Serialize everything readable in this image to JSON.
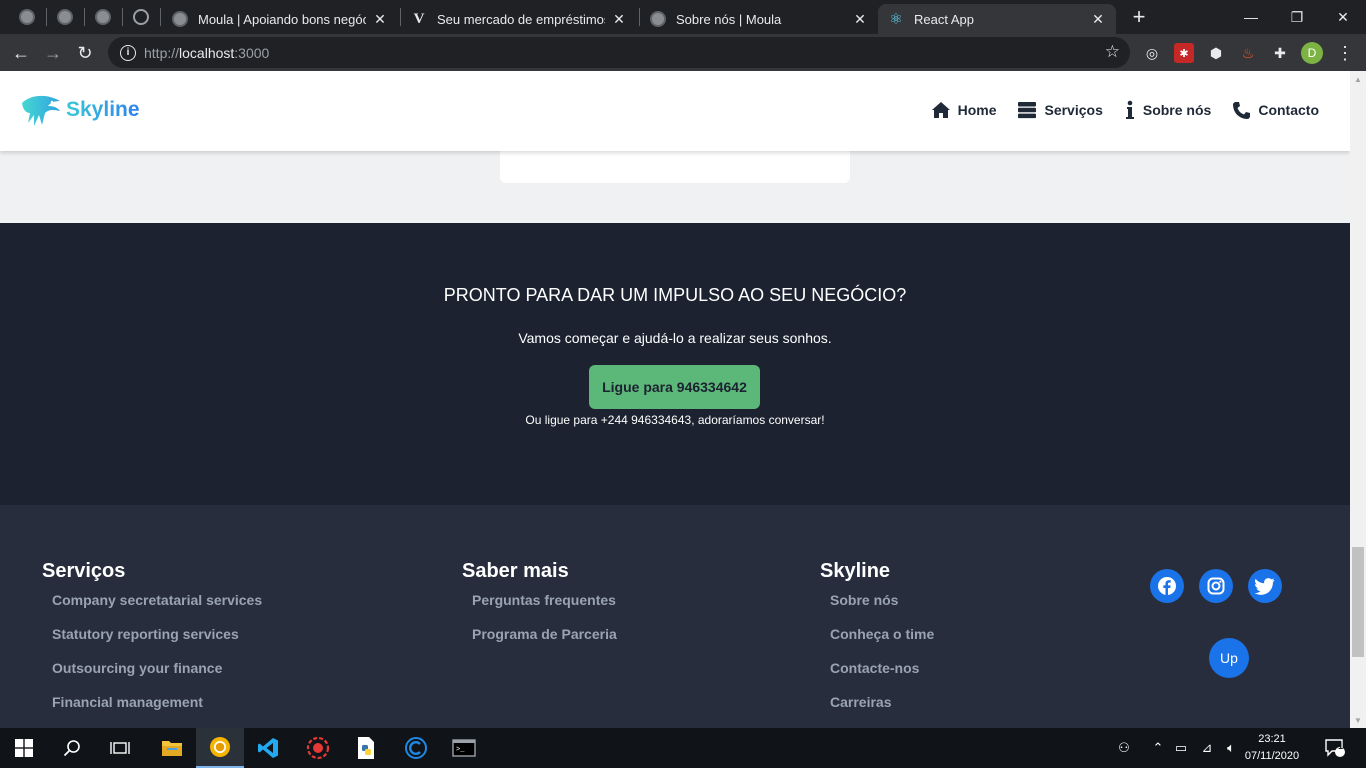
{
  "browser": {
    "tabs": [
      {
        "title": "Moula | Apoiando bons negócios",
        "favicon": "globe-icon"
      },
      {
        "title": "Seu mercado de empréstimos pa",
        "favicon": "v-logo-icon"
      },
      {
        "title": "Sobre nós | Moula",
        "favicon": "globe-icon"
      },
      {
        "title": "React App",
        "favicon": "react-icon",
        "active": true
      }
    ],
    "address": {
      "scheme": "http://",
      "host": "localhost",
      "port": ":3000"
    },
    "profile_initial": "D"
  },
  "header": {
    "brand": "Skyline",
    "nav": [
      {
        "label": "Home",
        "icon": "home-icon"
      },
      {
        "label": "Serviços",
        "icon": "server-icon"
      },
      {
        "label": "Sobre nós",
        "icon": "info-icon"
      },
      {
        "label": "Contacto",
        "icon": "phone-icon"
      }
    ]
  },
  "cta": {
    "title": "PRONTO PARA DAR UM IMPULSO AO SEU NEGÓCIO?",
    "subtitle": "Vamos começar e ajudá-lo a realizar seus sonhos.",
    "button_label": "Ligue para 946334642",
    "alt_text": "Ou ligue para +244 946334643, adoraríamos conversar!"
  },
  "footer": {
    "columns": [
      {
        "heading": "Serviços",
        "links": [
          "Company secretatarial services",
          "Statutory reporting services",
          "Outsourcing your finance",
          "Financial management"
        ]
      },
      {
        "heading": "Saber mais",
        "links": [
          "Perguntas frequentes",
          "Programa de Parceria"
        ]
      },
      {
        "heading": "Skyline",
        "links": [
          "Sobre nós",
          "Conheça o time",
          "Contacte-nos",
          "Carreiras"
        ]
      }
    ],
    "social": [
      "facebook-icon",
      "instagram-icon",
      "twitter-icon"
    ],
    "up_label": "Up"
  },
  "taskbar": {
    "time": "23:21",
    "date": "07/11/2020",
    "notifications": "1"
  },
  "colors": {
    "accent_green": "#5cb878",
    "cta_bg": "#1c2230",
    "footer_bg": "#272d3d",
    "social_blue": "#1a73e8"
  }
}
